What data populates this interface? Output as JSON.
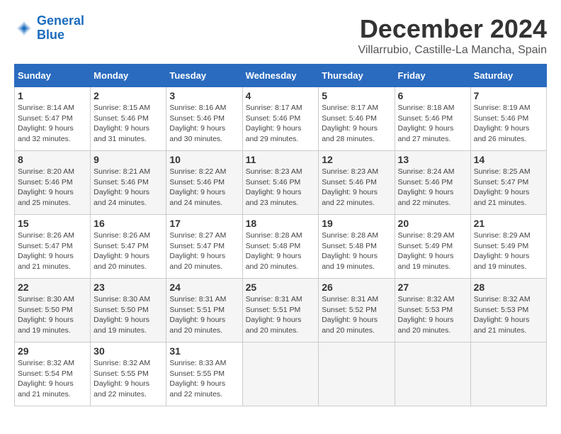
{
  "logo": {
    "line1": "General",
    "line2": "Blue"
  },
  "title": "December 2024",
  "location": "Villarrubio, Castille-La Mancha, Spain",
  "headers": [
    "Sunday",
    "Monday",
    "Tuesday",
    "Wednesday",
    "Thursday",
    "Friday",
    "Saturday"
  ],
  "weeks": [
    [
      {
        "day": "1",
        "sunrise": "Sunrise: 8:14 AM",
        "sunset": "Sunset: 5:47 PM",
        "daylight": "Daylight: 9 hours and 32 minutes."
      },
      {
        "day": "2",
        "sunrise": "Sunrise: 8:15 AM",
        "sunset": "Sunset: 5:46 PM",
        "daylight": "Daylight: 9 hours and 31 minutes."
      },
      {
        "day": "3",
        "sunrise": "Sunrise: 8:16 AM",
        "sunset": "Sunset: 5:46 PM",
        "daylight": "Daylight: 9 hours and 30 minutes."
      },
      {
        "day": "4",
        "sunrise": "Sunrise: 8:17 AM",
        "sunset": "Sunset: 5:46 PM",
        "daylight": "Daylight: 9 hours and 29 minutes."
      },
      {
        "day": "5",
        "sunrise": "Sunrise: 8:17 AM",
        "sunset": "Sunset: 5:46 PM",
        "daylight": "Daylight: 9 hours and 28 minutes."
      },
      {
        "day": "6",
        "sunrise": "Sunrise: 8:18 AM",
        "sunset": "Sunset: 5:46 PM",
        "daylight": "Daylight: 9 hours and 27 minutes."
      },
      {
        "day": "7",
        "sunrise": "Sunrise: 8:19 AM",
        "sunset": "Sunset: 5:46 PM",
        "daylight": "Daylight: 9 hours and 26 minutes."
      }
    ],
    [
      {
        "day": "8",
        "sunrise": "Sunrise: 8:20 AM",
        "sunset": "Sunset: 5:46 PM",
        "daylight": "Daylight: 9 hours and 25 minutes."
      },
      {
        "day": "9",
        "sunrise": "Sunrise: 8:21 AM",
        "sunset": "Sunset: 5:46 PM",
        "daylight": "Daylight: 9 hours and 24 minutes."
      },
      {
        "day": "10",
        "sunrise": "Sunrise: 8:22 AM",
        "sunset": "Sunset: 5:46 PM",
        "daylight": "Daylight: 9 hours and 24 minutes."
      },
      {
        "day": "11",
        "sunrise": "Sunrise: 8:23 AM",
        "sunset": "Sunset: 5:46 PM",
        "daylight": "Daylight: 9 hours and 23 minutes."
      },
      {
        "day": "12",
        "sunrise": "Sunrise: 8:23 AM",
        "sunset": "Sunset: 5:46 PM",
        "daylight": "Daylight: 9 hours and 22 minutes."
      },
      {
        "day": "13",
        "sunrise": "Sunrise: 8:24 AM",
        "sunset": "Sunset: 5:46 PM",
        "daylight": "Daylight: 9 hours and 22 minutes."
      },
      {
        "day": "14",
        "sunrise": "Sunrise: 8:25 AM",
        "sunset": "Sunset: 5:47 PM",
        "daylight": "Daylight: 9 hours and 21 minutes."
      }
    ],
    [
      {
        "day": "15",
        "sunrise": "Sunrise: 8:26 AM",
        "sunset": "Sunset: 5:47 PM",
        "daylight": "Daylight: 9 hours and 21 minutes."
      },
      {
        "day": "16",
        "sunrise": "Sunrise: 8:26 AM",
        "sunset": "Sunset: 5:47 PM",
        "daylight": "Daylight: 9 hours and 20 minutes."
      },
      {
        "day": "17",
        "sunrise": "Sunrise: 8:27 AM",
        "sunset": "Sunset: 5:47 PM",
        "daylight": "Daylight: 9 hours and 20 minutes."
      },
      {
        "day": "18",
        "sunrise": "Sunrise: 8:28 AM",
        "sunset": "Sunset: 5:48 PM",
        "daylight": "Daylight: 9 hours and 20 minutes."
      },
      {
        "day": "19",
        "sunrise": "Sunrise: 8:28 AM",
        "sunset": "Sunset: 5:48 PM",
        "daylight": "Daylight: 9 hours and 19 minutes."
      },
      {
        "day": "20",
        "sunrise": "Sunrise: 8:29 AM",
        "sunset": "Sunset: 5:49 PM",
        "daylight": "Daylight: 9 hours and 19 minutes."
      },
      {
        "day": "21",
        "sunrise": "Sunrise: 8:29 AM",
        "sunset": "Sunset: 5:49 PM",
        "daylight": "Daylight: 9 hours and 19 minutes."
      }
    ],
    [
      {
        "day": "22",
        "sunrise": "Sunrise: 8:30 AM",
        "sunset": "Sunset: 5:50 PM",
        "daylight": "Daylight: 9 hours and 19 minutes."
      },
      {
        "day": "23",
        "sunrise": "Sunrise: 8:30 AM",
        "sunset": "Sunset: 5:50 PM",
        "daylight": "Daylight: 9 hours and 19 minutes."
      },
      {
        "day": "24",
        "sunrise": "Sunrise: 8:31 AM",
        "sunset": "Sunset: 5:51 PM",
        "daylight": "Daylight: 9 hours and 20 minutes."
      },
      {
        "day": "25",
        "sunrise": "Sunrise: 8:31 AM",
        "sunset": "Sunset: 5:51 PM",
        "daylight": "Daylight: 9 hours and 20 minutes."
      },
      {
        "day": "26",
        "sunrise": "Sunrise: 8:31 AM",
        "sunset": "Sunset: 5:52 PM",
        "daylight": "Daylight: 9 hours and 20 minutes."
      },
      {
        "day": "27",
        "sunrise": "Sunrise: 8:32 AM",
        "sunset": "Sunset: 5:53 PM",
        "daylight": "Daylight: 9 hours and 20 minutes."
      },
      {
        "day": "28",
        "sunrise": "Sunrise: 8:32 AM",
        "sunset": "Sunset: 5:53 PM",
        "daylight": "Daylight: 9 hours and 21 minutes."
      }
    ],
    [
      {
        "day": "29",
        "sunrise": "Sunrise: 8:32 AM",
        "sunset": "Sunset: 5:54 PM",
        "daylight": "Daylight: 9 hours and 21 minutes."
      },
      {
        "day": "30",
        "sunrise": "Sunrise: 8:32 AM",
        "sunset": "Sunset: 5:55 PM",
        "daylight": "Daylight: 9 hours and 22 minutes."
      },
      {
        "day": "31",
        "sunrise": "Sunrise: 8:33 AM",
        "sunset": "Sunset: 5:55 PM",
        "daylight": "Daylight: 9 hours and 22 minutes."
      },
      null,
      null,
      null,
      null
    ]
  ]
}
